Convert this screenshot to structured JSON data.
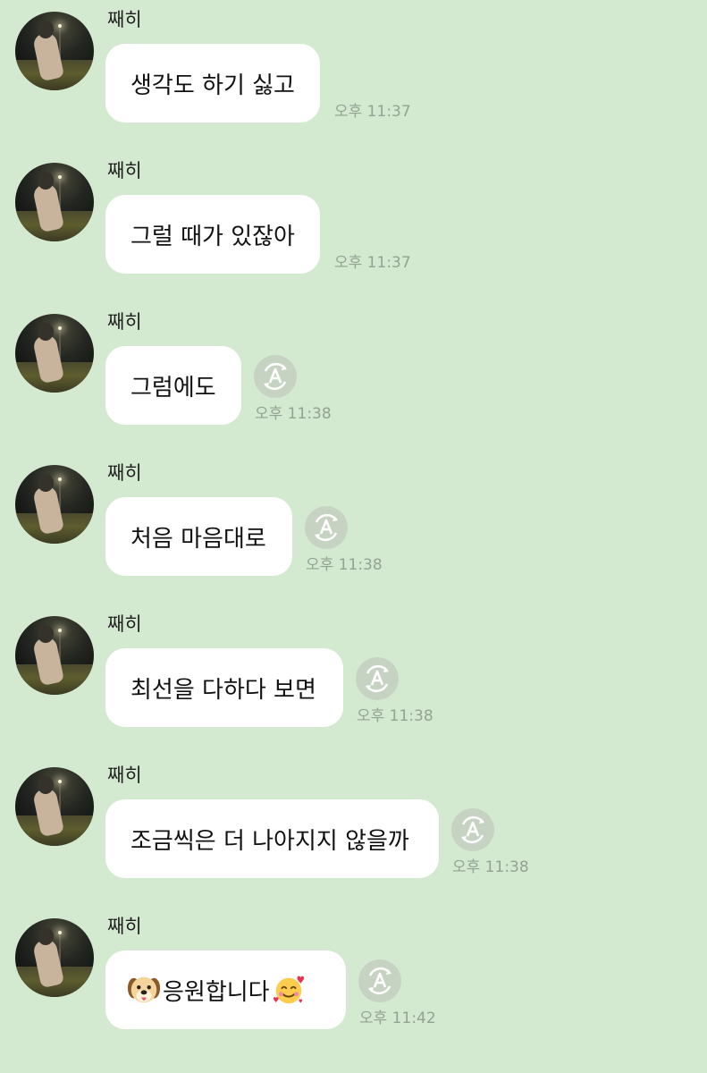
{
  "messages": [
    {
      "sender": "째히",
      "text": "생각도 하기 싫고",
      "time": "오후 11:37",
      "has_translate": false
    },
    {
      "sender": "째히",
      "text": "그럴 때가 있잖아",
      "time": "오후 11:37",
      "has_translate": false
    },
    {
      "sender": "째히",
      "text": "그럼에도",
      "time": "오후 11:38",
      "has_translate": true
    },
    {
      "sender": "째히",
      "text": "처음 마음대로",
      "time": "오후 11:38",
      "has_translate": true
    },
    {
      "sender": "째히",
      "text": "최선을 다하다 보면",
      "time": "오후 11:38",
      "has_translate": true
    },
    {
      "sender": "째히",
      "text": "조금씩은 더 나아지지 않을까",
      "time": "오후 11:38",
      "has_translate": true
    },
    {
      "sender": "째히",
      "text": "응원합니다",
      "time": "오후 11:42",
      "has_translate": true,
      "leading_emoji": "dog-face-emoji",
      "trailing_emoji": "smiling-face-with-hearts-emoji"
    }
  ],
  "colors": {
    "chat_background": "#d4ead0",
    "bubble_background": "#ffffff",
    "timestamp_text": "#93a393",
    "translate_button": "#c6d3c3"
  },
  "icons": {
    "translate_button_icon": "auto-translate-icon"
  }
}
